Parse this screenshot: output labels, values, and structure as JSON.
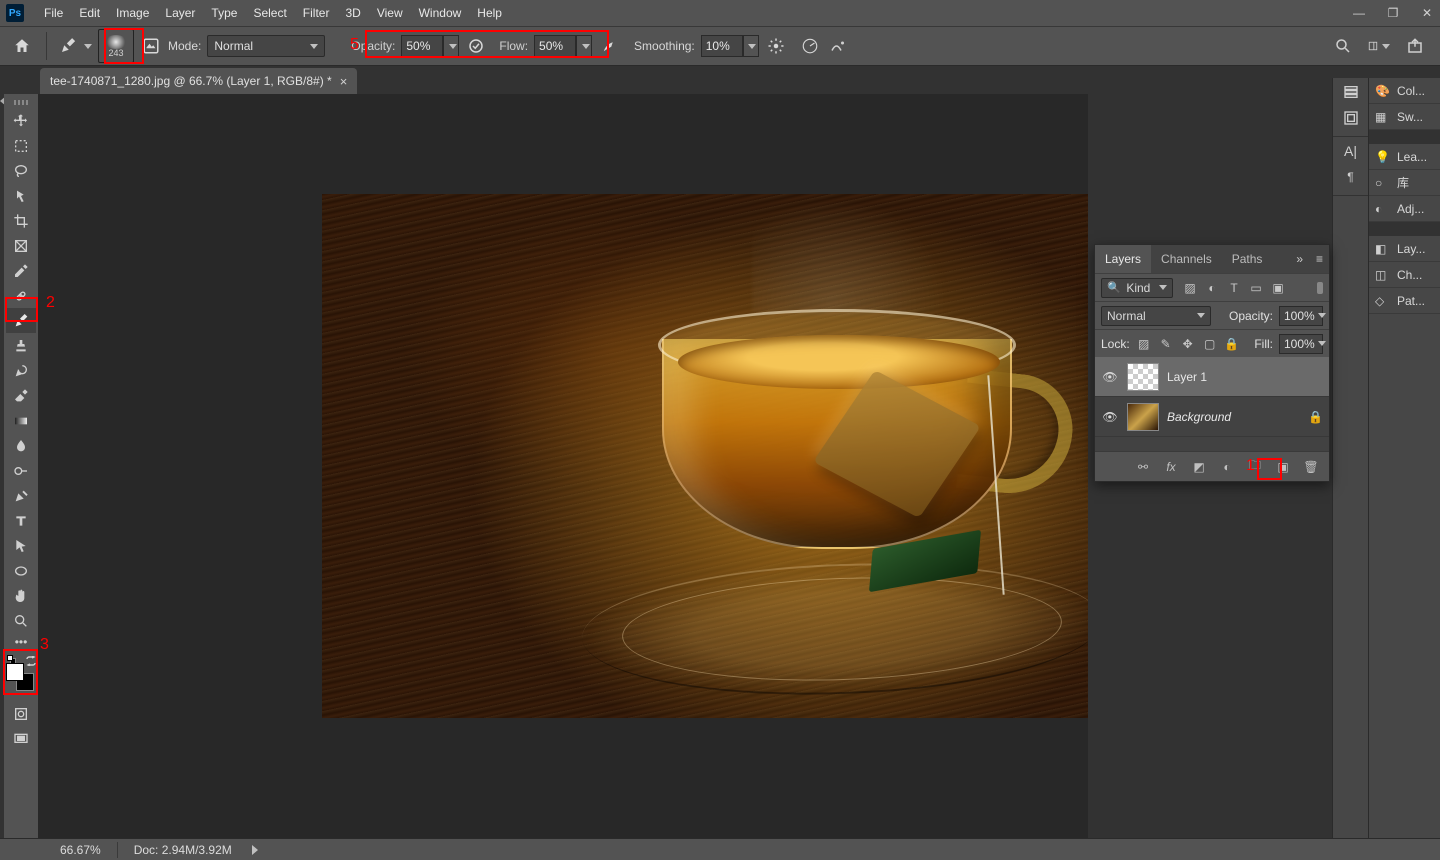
{
  "menu": {
    "items": [
      "File",
      "Edit",
      "Image",
      "Layer",
      "Type",
      "Select",
      "Filter",
      "3D",
      "View",
      "Window",
      "Help"
    ]
  },
  "options": {
    "brush_size": "243",
    "mode_label": "Mode:",
    "mode_value": "Normal",
    "opacity_label": "Opacity:",
    "opacity_value": "50%",
    "flow_label": "Flow:",
    "flow_value": "50%",
    "smoothing_label": "Smoothing:",
    "smoothing_value": "10%"
  },
  "document": {
    "tab_title": "tee-1740871_1280.jpg @ 66.7% (Layer 1, RGB/8#) *"
  },
  "right_panels": {
    "list": [
      "Col...",
      "Sw...",
      "Lea...",
      "库",
      "Adj...",
      "Lay...",
      "Ch...",
      "Pat..."
    ]
  },
  "layers": {
    "tabs": [
      "Layers",
      "Channels",
      "Paths"
    ],
    "kind_label": "Kind",
    "blend_mode": "Normal",
    "opacity_label": "Opacity:",
    "opacity_value": "100%",
    "lock_label": "Lock:",
    "fill_label": "Fill:",
    "fill_value": "100%",
    "items": [
      {
        "name": "Layer 1",
        "bg": false
      },
      {
        "name": "Background",
        "bg": true
      }
    ]
  },
  "status": {
    "zoom": "66.67%",
    "doc": "Doc: 2.94M/3.92M"
  },
  "annotations": {
    "n1": "1",
    "n2": "2",
    "n3": "3",
    "n5": "5"
  },
  "search_ph": "Kind"
}
